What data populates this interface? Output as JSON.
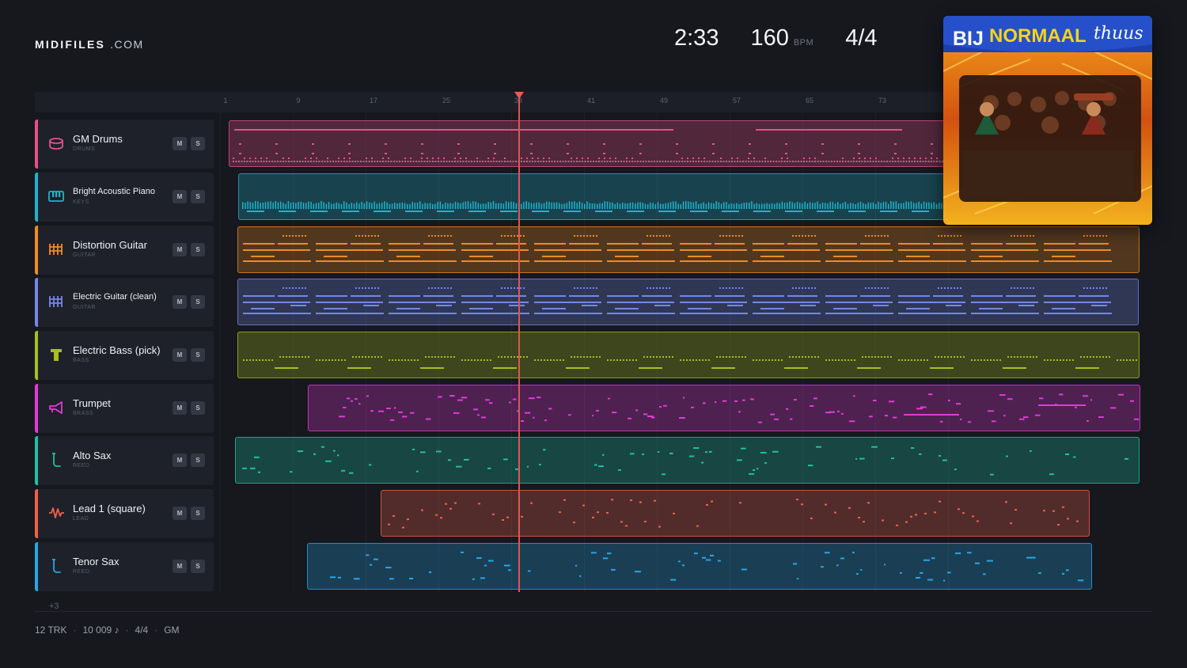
{
  "brand": {
    "name": "MIDIFILES",
    "domain": ".COM"
  },
  "stats": {
    "time": "2:33",
    "bpm": "160",
    "bpm_unit": "BPM",
    "signature": "4/4"
  },
  "ruler": {
    "ticks": [
      "1",
      "9",
      "17",
      "25",
      "33",
      "41",
      "49",
      "57",
      "65",
      "73"
    ]
  },
  "controls": {
    "mute": "M",
    "solo": "S"
  },
  "tracks": [
    {
      "name": "GM Drums",
      "category": "DRUMS",
      "color": "#e8508a",
      "icon": "drum-icon"
    },
    {
      "name": "Bright Acoustic Piano",
      "category": "KEYS",
      "color": "#1fb3cc",
      "icon": "piano-icon"
    },
    {
      "name": "Distortion Guitar",
      "category": "GUITAR",
      "color": "#f08a24",
      "icon": "guitar-grid-icon"
    },
    {
      "name": "Electric Guitar (clean)",
      "category": "GUITAR",
      "color": "#7487e6",
      "icon": "guitar-grid-icon"
    },
    {
      "name": "Electric Bass (pick)",
      "category": "BASS",
      "color": "#a6c01c",
      "icon": "bass-icon"
    },
    {
      "name": "Trumpet",
      "category": "BRASS",
      "color": "#e23ad8",
      "icon": "trumpet-icon"
    },
    {
      "name": "Alto Sax",
      "category": "REED",
      "color": "#1fc0a3",
      "icon": "sax-icon"
    },
    {
      "name": "Lead 1 (square)",
      "category": "LEAD",
      "color": "#f0614a",
      "icon": "wave-icon"
    },
    {
      "name": "Tenor Sax",
      "category": "REED",
      "color": "#27a6e6",
      "icon": "sax-icon"
    }
  ],
  "more_tracks": "+3",
  "footer": {
    "tracks": "12 TRK",
    "notes": "10 009 ♪",
    "signature": "4/4",
    "standard": "GM"
  },
  "album": {
    "title_part1": "BIJ",
    "title_part2": "NORMAAL",
    "title_part3": "thuus"
  }
}
